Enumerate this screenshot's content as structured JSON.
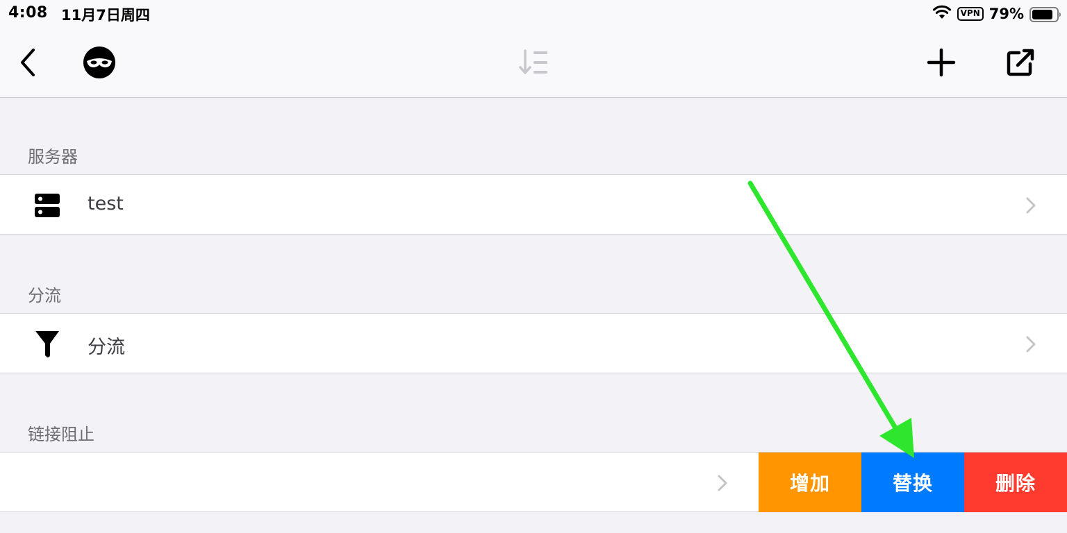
{
  "status_bar": {
    "time": "4:08",
    "date": "11月7日周四",
    "vpn": "VPN",
    "battery": "79%"
  },
  "nav": {
    "back_icon": "chevron-left-icon",
    "mask_icon": "incognito-mask-icon",
    "sort_icon": "sort-descending-icon",
    "add_icon": "plus-icon",
    "share_icon": "external-link-icon"
  },
  "sections": [
    {
      "header": "服务器",
      "row": {
        "label": "test",
        "icon": "server-icon"
      }
    },
    {
      "header": "分流",
      "row": {
        "label": "分流",
        "icon": "funnel-icon"
      }
    },
    {
      "header": "链接阻止",
      "row": {
        "label": "",
        "icon": ""
      }
    }
  ],
  "swipe_actions": {
    "add": "增加",
    "replace": "替换",
    "delete": "删除"
  },
  "colors": {
    "add": "#ff9500",
    "replace": "#007aff",
    "delete": "#ff3b30",
    "annotation_arrow": "#2ee62e"
  }
}
